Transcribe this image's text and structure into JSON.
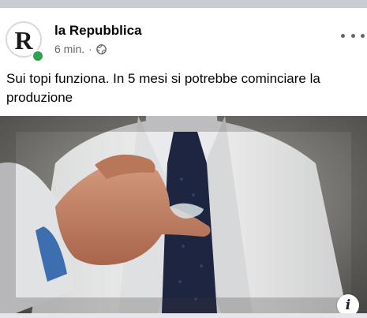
{
  "post": {
    "page_name": "la Repubblica",
    "avatar_letter": "R",
    "time": "6 min.",
    "separator": "·",
    "audience_icon": "globe-icon",
    "text": "Sui topi funziona. In 5 mesi si potrebbe cominciare la produzione",
    "info_glyph": "i"
  },
  "colors": {
    "online": "#31a24c",
    "secondary_text": "#65676b",
    "divider": "#c9ccd1"
  }
}
